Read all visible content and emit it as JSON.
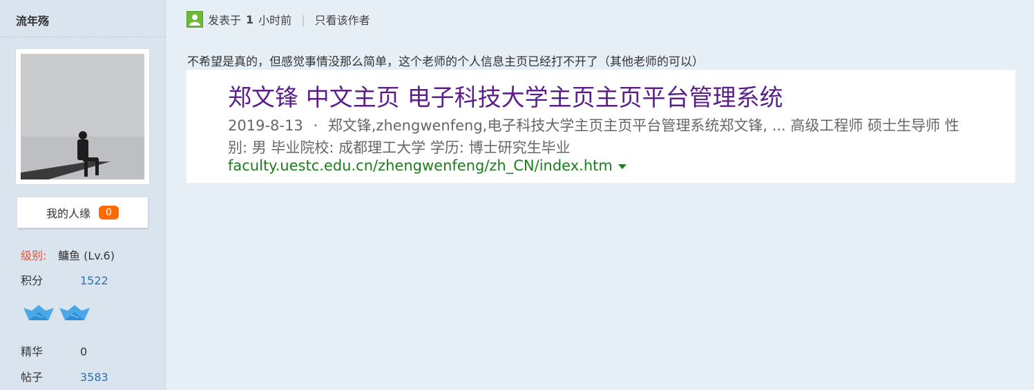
{
  "sidebar": {
    "username": "流年殇",
    "renyuan": {
      "label": "我的人缘",
      "count": "0"
    },
    "level": {
      "label": "级别:",
      "value": "鳙鱼 (Lv.6)"
    },
    "points": {
      "label": "积分",
      "value": "1522"
    },
    "badges": [
      "paper-boat-icon",
      "paper-boat-icon"
    ],
    "essence": {
      "label": "精华",
      "value": "0"
    },
    "posts": {
      "label": "帖子",
      "value": "3583"
    }
  },
  "post": {
    "posted": "发表于",
    "time_num": "1",
    "time_unit": "小时前",
    "separator": "|",
    "only_author": "只看该作者",
    "text": "不希望是真的，但感觉事情没那么简单，这个老师的个人信息主页已经打不开了（其他老师的可以）"
  },
  "search_result": {
    "title": "郑文锋 中文主页 电子科技大学主页主页平台管理系统",
    "snippet_date": "2019-8-13",
    "snippet_dot": "·",
    "snippet_text": "郑文锋,zhengwenfeng,电子科技大学主页主页平台管理系统郑文锋, ... 高级工程师 硕士生导师 性别: 男 毕业院校: 成都理工大学 学历: 博士研究生毕业",
    "url": "faculty.uestc.edu.cn/zhengwenfeng/zh_CN/index.htm"
  },
  "colors": {
    "title": "#5c1e8a",
    "url": "#1e7b1e",
    "count_badge": "#ff6b00",
    "level_label": "#e0533a",
    "link_value": "#2b6fb3"
  }
}
